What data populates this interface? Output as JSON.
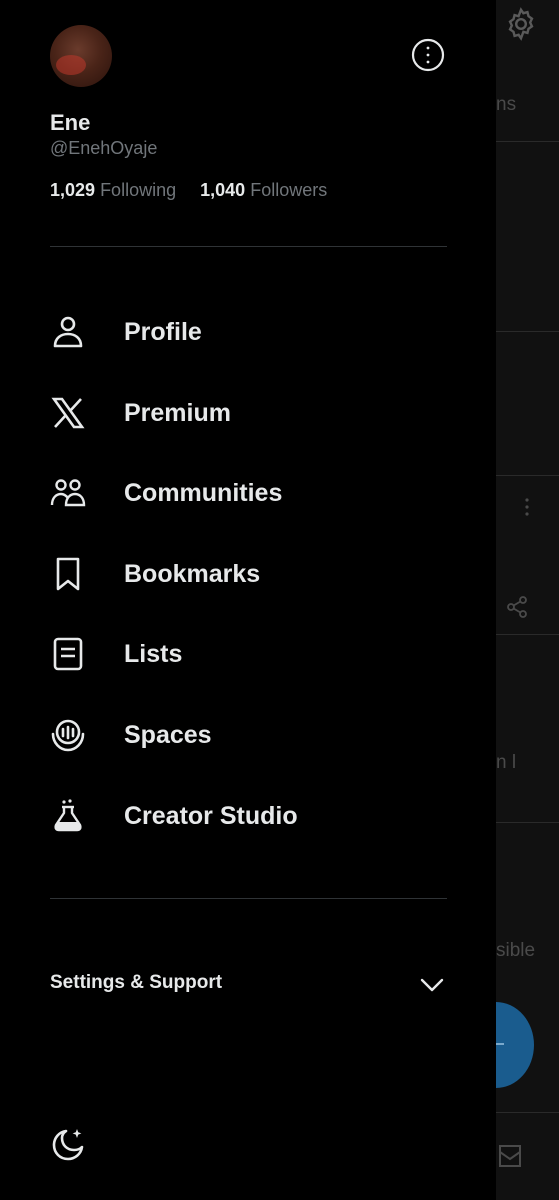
{
  "background": {
    "partial_texts": [
      "ns",
      "n l",
      "sible"
    ],
    "icons": [
      "gear-icon",
      "more-vertical-icon",
      "share-icon",
      "compose-fab",
      "mail-icon"
    ],
    "fab_color": "#1a5c8e"
  },
  "profile": {
    "name": "Ene",
    "handle": "@EnehOyaje",
    "following_count": "1,029",
    "following_label": "Following",
    "followers_count": "1,040",
    "followers_label": "Followers"
  },
  "menu": {
    "items": [
      {
        "label": "Profile",
        "icon": "user-icon"
      },
      {
        "label": "Premium",
        "icon": "x-logo-icon"
      },
      {
        "label": "Communities",
        "icon": "communities-icon"
      },
      {
        "label": "Bookmarks",
        "icon": "bookmark-icon"
      },
      {
        "label": "Lists",
        "icon": "list-icon"
      },
      {
        "label": "Spaces",
        "icon": "spaces-icon"
      },
      {
        "label": "Creator Studio",
        "icon": "flask-icon"
      }
    ]
  },
  "settings": {
    "label": "Settings & Support"
  },
  "colors": {
    "text_primary": "#e7e9ea",
    "text_secondary": "#71767b",
    "divider": "#2f3336"
  }
}
